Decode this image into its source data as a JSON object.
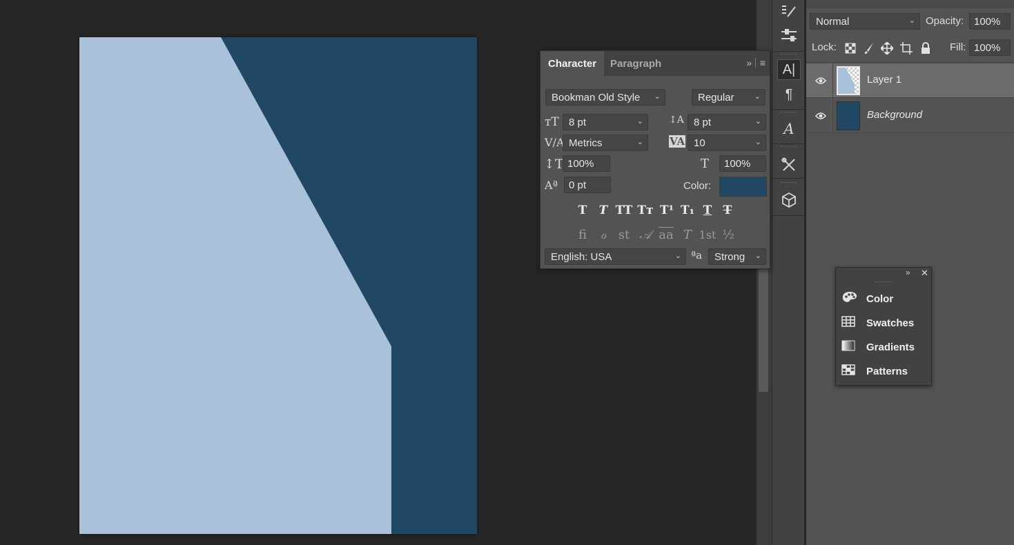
{
  "canvas": {
    "document_colors": {
      "background": "#204763",
      "layer1": "#aac2d9"
    }
  },
  "character_panel": {
    "tabs": [
      "Character",
      "Paragraph"
    ],
    "font_family": "Bookman Old Style",
    "font_style": "Regular",
    "font_size": "8 pt",
    "leading": "8 pt",
    "kerning": "Metrics",
    "tracking": "10",
    "vertical_scale": "100%",
    "horizontal_scale": "100%",
    "baseline_shift": "0 pt",
    "color_label": "Color:",
    "color_value": "#204763",
    "type_buttons": [
      "T",
      "T",
      "TT",
      "Tт",
      "T¹",
      "T₁",
      "T",
      "T"
    ],
    "opentype_buttons": [
      "ﬁ",
      "ℴ",
      "st",
      "𝒜",
      "aa",
      "T",
      "1st",
      "½"
    ],
    "language": "English: USA",
    "antialias_icon": "ªa",
    "antialias": "Strong"
  },
  "layers_panel": {
    "blend_mode": "Normal",
    "opacity_label": "Opacity:",
    "opacity": "100%",
    "lock_label": "Lock:",
    "fill_label": "Fill:",
    "fill": "100%",
    "layers": [
      {
        "name": "Layer 1",
        "selected": true,
        "italic": false
      },
      {
        "name": "Background",
        "selected": false,
        "italic": true
      }
    ]
  },
  "dock": {
    "icons": [
      "brush-settings-icon",
      "adjust-icon",
      "character-icon",
      "paragraph-icon",
      "glyphs-icon",
      "tools-icon",
      "3d-icon"
    ]
  },
  "float_panel": {
    "items": [
      {
        "label": "Color",
        "icon": "palette-icon"
      },
      {
        "label": "Swatches",
        "icon": "swatches-icon"
      },
      {
        "label": "Gradients",
        "icon": "gradient-icon"
      },
      {
        "label": "Patterns",
        "icon": "patterns-icon"
      }
    ]
  }
}
